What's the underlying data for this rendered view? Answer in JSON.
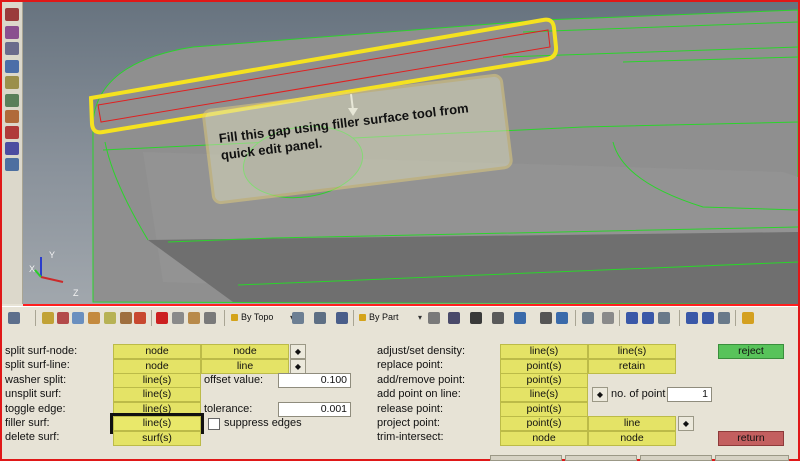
{
  "viewport": {
    "annotation": "Fill this gap using filler surface tool from quick edit panel.",
    "triad": {
      "x": "X",
      "y": "Y",
      "z": "Z"
    }
  },
  "toolbar": {
    "by_topo": "By Topo",
    "by_part": "By Part"
  },
  "panel": {
    "rows_left": [
      {
        "label": "split surf-node:",
        "b1": "node",
        "b2": "node"
      },
      {
        "label": "split surf-line:",
        "b1": "node",
        "b2": "line"
      },
      {
        "label": "washer split:",
        "b1": "line(s)",
        "extra_label": "offset value:",
        "value": "0.100"
      },
      {
        "label": "unsplit surf:",
        "b1": "line(s)"
      },
      {
        "label": "toggle edge:",
        "b1": "line(s)",
        "extra_label": "tolerance:",
        "value": "0.001"
      },
      {
        "label": "filler surf:",
        "b1": "line(s)",
        "extra_label": "suppress edges"
      },
      {
        "label": "delete surf:",
        "b1": "surf(s)"
      }
    ],
    "rows_right": [
      {
        "label": "adjust/set density:",
        "b1": "line(s)",
        "b2": "line(s)"
      },
      {
        "label": "replace point:",
        "b1": "point(s)",
        "b2": "retain"
      },
      {
        "label": "add/remove point:",
        "b1": "point(s)"
      },
      {
        "label": "add point on line:",
        "b1": "line(s)",
        "extra_label": "no. of point",
        "value": "1"
      },
      {
        "label": "release point:",
        "b1": "point(s)"
      },
      {
        "label": "project point:",
        "b1": "point(s)",
        "b2": "line"
      },
      {
        "label": "trim-intersect:",
        "b1": "node",
        "b2": "node"
      }
    ],
    "reject": "reject",
    "return": "return"
  },
  "colors": {
    "button": "#e4e366",
    "reject": "#58c35a",
    "return": "#c35f5f",
    "highlight": "#f5e21f",
    "edge": "#2bd42b"
  }
}
